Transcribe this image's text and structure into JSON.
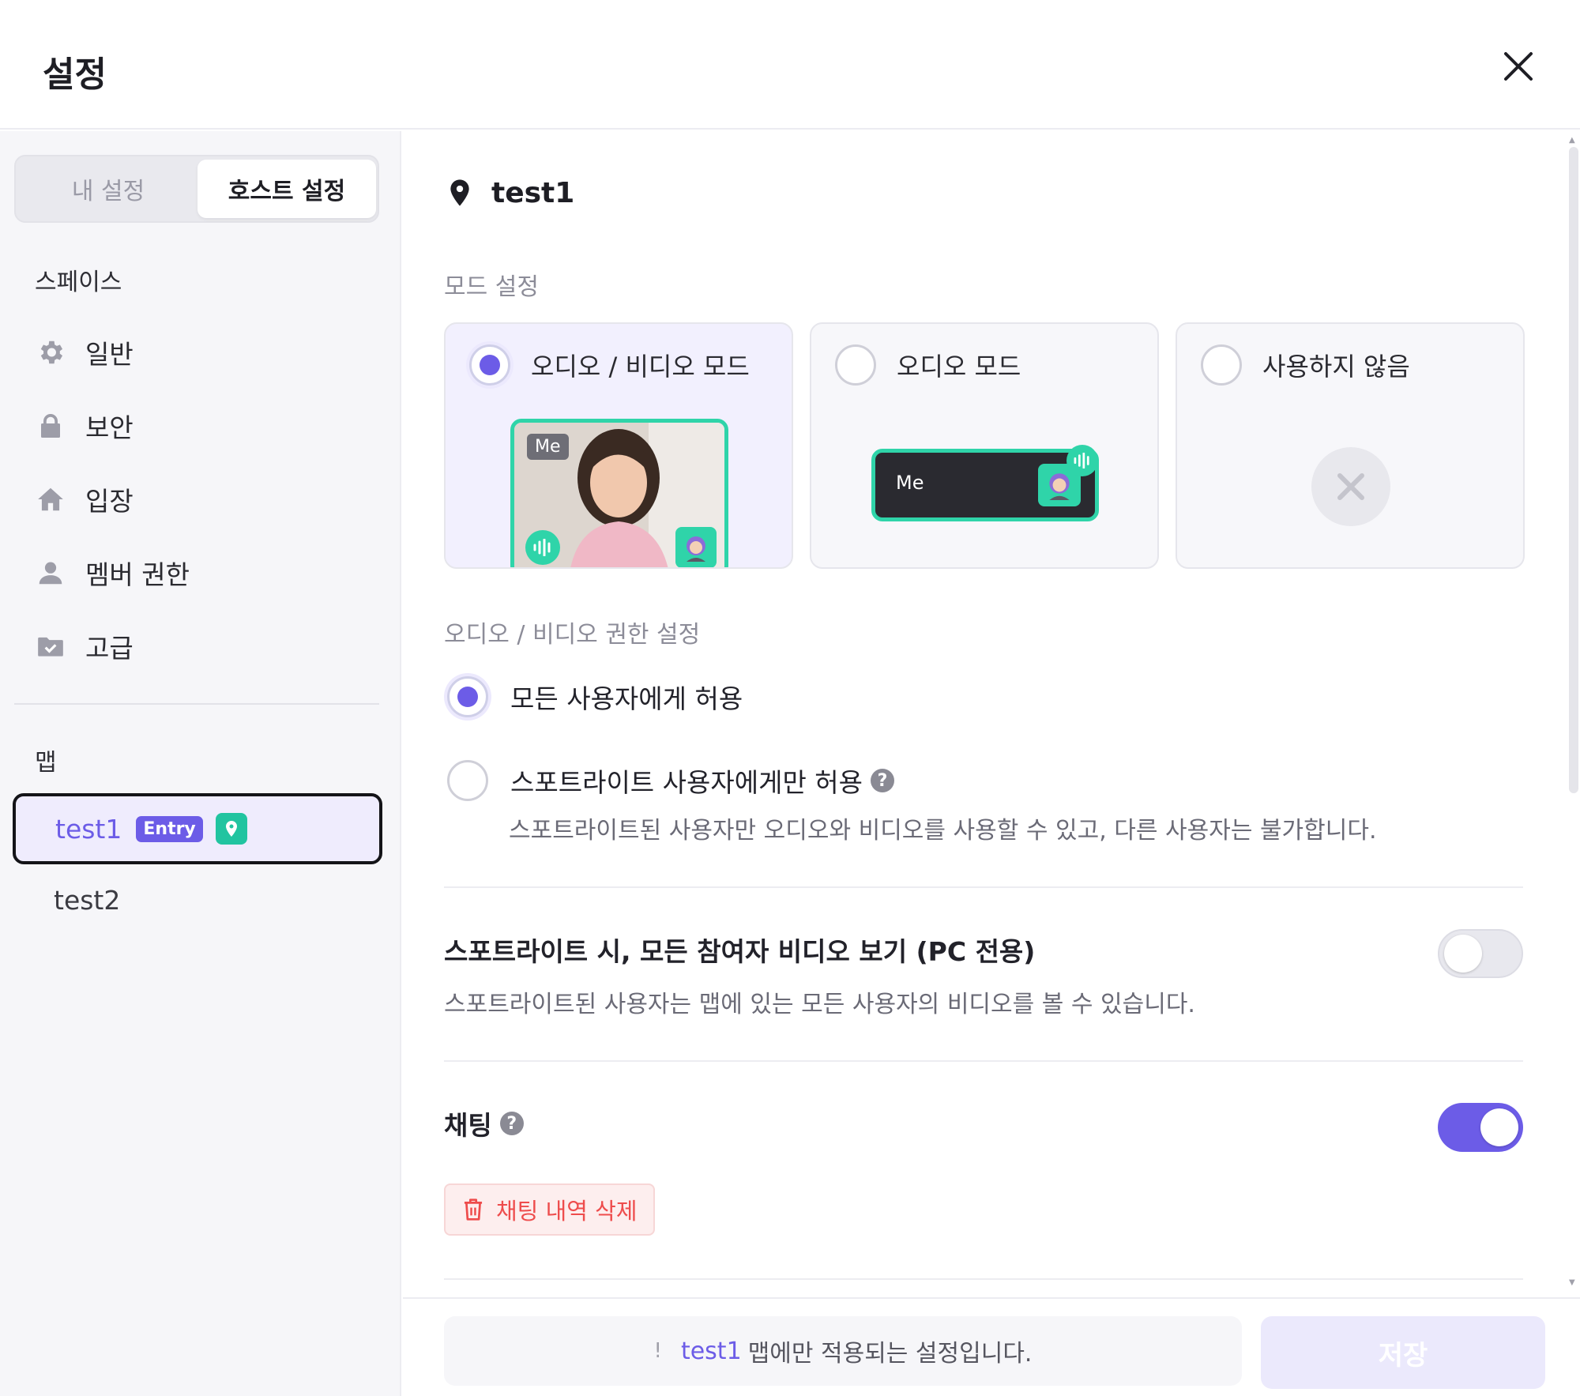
{
  "header": {
    "title": "설정"
  },
  "sidebar": {
    "tabs": [
      {
        "label": "내 설정",
        "active": false
      },
      {
        "label": "호스트 설정",
        "active": true
      }
    ],
    "space_section": "스페이스",
    "items": [
      {
        "label": "일반",
        "icon": "gear-icon"
      },
      {
        "label": "보안",
        "icon": "lock-icon"
      },
      {
        "label": "입장",
        "icon": "home-icon"
      },
      {
        "label": "멤버 권한",
        "icon": "user-icon"
      },
      {
        "label": "고급",
        "icon": "folder-icon"
      }
    ],
    "map_section": "맵",
    "maps": [
      {
        "label": "test1",
        "badge": "Entry",
        "selected": true
      },
      {
        "label": "test2",
        "selected": false
      }
    ]
  },
  "main": {
    "map_name": "test1",
    "mode_section": "모드 설정",
    "modes": [
      {
        "label": "오디오 / 비디오 모드",
        "selected": true,
        "preview_tag": "Me"
      },
      {
        "label": "오디오 모드",
        "selected": false,
        "preview_tag": "Me"
      },
      {
        "label": "사용하지 않음",
        "selected": false
      }
    ],
    "permission_section": "오디오 / 비디오 권한 설정",
    "permissions": [
      {
        "label": "모든 사용자에게 허용",
        "selected": true
      },
      {
        "label": "스포트라이트 사용자에게만 허용",
        "selected": false,
        "description": "스포트라이트된 사용자만 오디오와 비디오를 사용할 수 있고, 다른 사용자는 불가합니다."
      }
    ],
    "spotlight_video": {
      "title": "스포트라이트 시, 모든 참여자 비디오 보기 (PC 전용)",
      "description": "스포트라이트된 사용자는 맵에 있는 모든 사용자의 비디오를 볼 수 있습니다.",
      "enabled": false
    },
    "chat": {
      "title": "채팅",
      "enabled": true,
      "delete_label": "채팅 내역 삭제"
    }
  },
  "footer": {
    "notice_icon": "!",
    "notice_map": "test1",
    "notice_text": "맵에만 적용되는 설정입니다.",
    "save_label": "저장"
  },
  "colors": {
    "accent": "#6c5ce7",
    "mint": "#21c4a0",
    "danger": "#ee4c4c"
  }
}
